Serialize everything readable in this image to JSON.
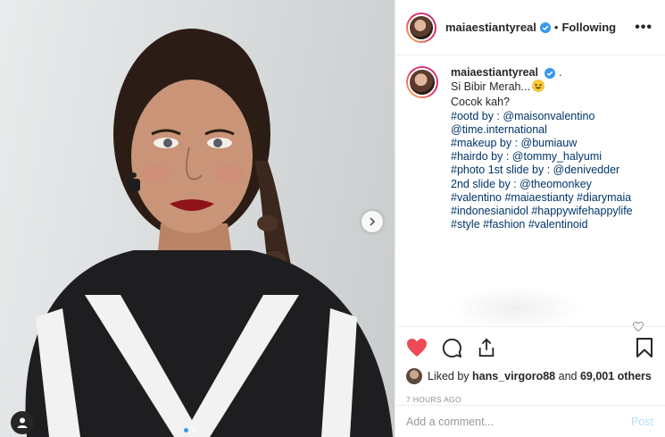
{
  "post": {
    "username": "maiaestiantyreal",
    "follow_status": "Following",
    "separator": "•",
    "more_label": "•••",
    "caption": {
      "username": "maiaestiantyreal",
      "dot": ".",
      "lines": [
        "Si Bibir Merah...",
        "Cocok kah?",
        "#ootd by : @maisonvalentino",
        "@time.international",
        "#makeup by : @bumiauw",
        "#hairdo by : @tommy_halyumi",
        "#photo 1st slide by : @denivedder",
        "2nd slide by : @theomonkey",
        "#valentino #maiaestianty #diarymaia",
        "#indonesianidol #happywifehappylife",
        "#style #fashion #valentinoid"
      ],
      "emoji": "grinning-squint-emoji"
    },
    "likes": {
      "prefix": "Liked by",
      "user": "hans_virgoro88",
      "middle": "and",
      "count_label": "69,001 others"
    },
    "time_ago": "7 HOURS AGO",
    "comment": {
      "placeholder": "Add a comment...",
      "post_label": "Post"
    },
    "carousel": {
      "slides": 2,
      "active_index": 0
    },
    "liked_by_viewer": true
  },
  "icons": {
    "verified": "verified-badge-icon",
    "heart": "heart-icon",
    "comment": "comment-icon",
    "share": "share-icon",
    "save": "bookmark-icon",
    "next": "chevron-right-icon",
    "tag": "user-tag-icon",
    "like_comment": "small-heart-icon"
  },
  "colors": {
    "link": "#003569",
    "like_red": "#ed4956",
    "verified_blue": "#3897f0",
    "post_disabled": "#b2dffc",
    "muted": "#8e8e8e"
  }
}
